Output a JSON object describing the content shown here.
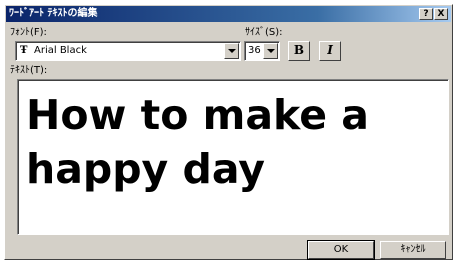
{
  "window": {
    "title": "ﾜｰﾄﾞｱｰﾄ ﾃｷｽﾄの編集",
    "help_label": "?",
    "close_label": "X"
  },
  "font": {
    "label": "ﾌｫﾝﾄ(F):",
    "value": "Arial Black",
    "type_icon": "Ŧ"
  },
  "size": {
    "label": "ｻｲｽﾞ(S):",
    "value": "36"
  },
  "style": {
    "bold_label": "B",
    "italic_label": "I"
  },
  "text": {
    "label": "ﾃｷｽﾄ(T):",
    "value": "How to make a\nhappy day"
  },
  "buttons": {
    "ok_label": "OK",
    "cancel_label": "ｷｬﾝｾﾙ"
  }
}
